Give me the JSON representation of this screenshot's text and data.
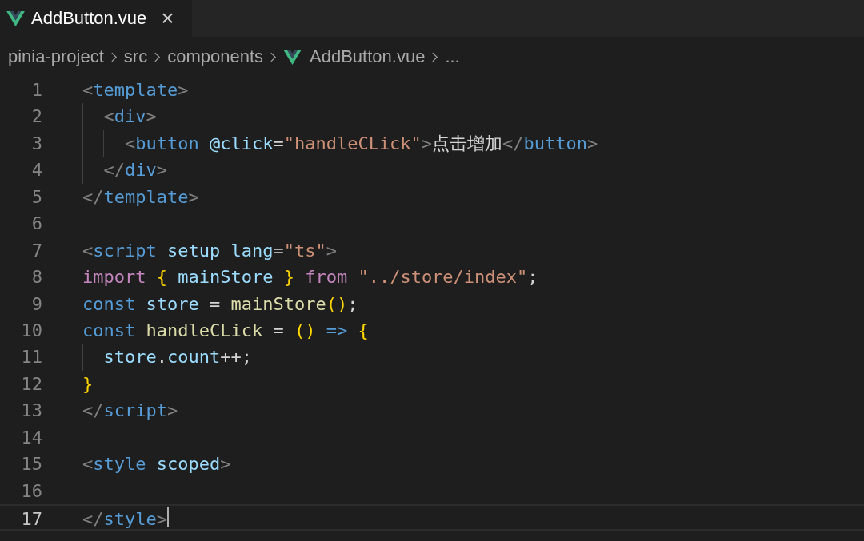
{
  "tabs": [
    {
      "label": "AddButton.vue",
      "selected": true,
      "close": "×"
    }
  ],
  "breadcrumb": [
    {
      "text": "pinia-project",
      "kind": "folder"
    },
    {
      "text": "src",
      "kind": "folder"
    },
    {
      "text": "components",
      "kind": "folder"
    },
    {
      "text": "AddButton.vue",
      "kind": "vue"
    },
    {
      "text": "...",
      "kind": "more"
    }
  ],
  "code": [
    {
      "number": "1",
      "current": false,
      "tokens": [
        {
          "t": "<",
          "color": "#808080"
        },
        {
          "t": "template",
          "color": "#569cd6"
        },
        {
          "t": ">",
          "color": "#808080"
        }
      ]
    },
    {
      "number": "2",
      "current": false,
      "tokens": [
        {
          "t": "  <",
          "color": "#808080"
        },
        {
          "t": "div",
          "color": "#569cd6"
        },
        {
          "t": ">",
          "color": "#808080"
        }
      ]
    },
    {
      "number": "3",
      "current": false,
      "tokens": [
        {
          "t": "    <",
          "color": "#808080"
        },
        {
          "t": "button",
          "color": "#569cd6"
        },
        {
          "t": " @click",
          "color": "#9cdcfe"
        },
        {
          "t": "=",
          "color": "#d4d4d4"
        },
        {
          "t": "\"handleCLick\"",
          "color": "#ce9178"
        },
        {
          "t": ">",
          "color": "#808080"
        },
        {
          "t": "点击增加",
          "color": "#d4d4d4"
        },
        {
          "t": "</",
          "color": "#808080"
        },
        {
          "t": "button",
          "color": "#569cd6"
        },
        {
          "t": ">",
          "color": "#808080"
        }
      ]
    },
    {
      "number": "4",
      "current": false,
      "tokens": [
        {
          "t": "  </",
          "color": "#808080"
        },
        {
          "t": "div",
          "color": "#569cd6"
        },
        {
          "t": ">",
          "color": "#808080"
        }
      ]
    },
    {
      "number": "5",
      "current": false,
      "tokens": [
        {
          "t": "</",
          "color": "#808080"
        },
        {
          "t": "template",
          "color": "#569cd6"
        },
        {
          "t": ">",
          "color": "#808080"
        }
      ]
    },
    {
      "number": "6",
      "current": false
    },
    {
      "number": "7",
      "current": false,
      "tokens": [
        {
          "t": "<",
          "color": "#808080"
        },
        {
          "t": "script",
          "color": "#569cd6"
        },
        {
          "t": " setup lang",
          "color": "#9cdcfe"
        },
        {
          "t": "=",
          "color": "#d4d4d4"
        },
        {
          "t": "\"ts\"",
          "color": "#ce9178"
        },
        {
          "t": ">",
          "color": "#808080"
        }
      ]
    },
    {
      "number": "8",
      "current": false,
      "tokens": [
        {
          "t": "import ",
          "color": "#c586c0"
        },
        {
          "t": "{",
          "color": "#ffd700"
        },
        {
          "t": " mainStore ",
          "color": "#9cdcfe"
        },
        {
          "t": "}",
          "color": "#ffd700"
        },
        {
          "t": " from ",
          "color": "#c586c0"
        },
        {
          "t": "\"../store/index\"",
          "color": "#ce9178"
        },
        {
          "t": ";",
          "color": "#d4d4d4"
        }
      ]
    },
    {
      "number": "9",
      "current": false,
      "tokens": [
        {
          "t": "const",
          "color": "#569cd6"
        },
        {
          "t": " store ",
          "color": "#9cdcfe"
        },
        {
          "t": "= ",
          "color": "#d4d4d4"
        },
        {
          "t": "mainStore",
          "color": "#dcdcaa"
        },
        {
          "t": "()",
          "color": "#ffd700"
        },
        {
          "t": ";",
          "color": "#d4d4d4"
        }
      ]
    },
    {
      "number": "10",
      "current": false,
      "tokens": [
        {
          "t": "const",
          "color": "#569cd6"
        },
        {
          "t": " handleCLick",
          "color": "#dcdcaa"
        },
        {
          "t": " = ",
          "color": "#d4d4d4"
        },
        {
          "t": "()",
          "color": "#ffd700"
        },
        {
          "t": " => ",
          "color": "#569cd6"
        },
        {
          "t": "{",
          "color": "#ffd700"
        }
      ]
    },
    {
      "number": "11",
      "current": false,
      "tokens": [
        {
          "t": "  store",
          "color": "#9cdcfe"
        },
        {
          "t": ".",
          "color": "#d4d4d4"
        },
        {
          "t": "count",
          "color": "#9cdcfe"
        },
        {
          "t": "++;",
          "color": "#d4d4d4"
        }
      ]
    },
    {
      "number": "12",
      "current": false,
      "tokens": [
        {
          "t": "}",
          "color": "#ffd700"
        }
      ]
    },
    {
      "number": "13",
      "current": false,
      "tokens": [
        {
          "t": "</",
          "color": "#808080"
        },
        {
          "t": "script",
          "color": "#569cd6"
        },
        {
          "t": ">",
          "color": "#808080"
        }
      ]
    },
    {
      "number": "14",
      "current": false
    },
    {
      "number": "15",
      "current": false,
      "tokens": [
        {
          "t": "<",
          "color": "#808080"
        },
        {
          "t": "style",
          "color": "#569cd6"
        },
        {
          "t": " scoped",
          "color": "#9cdcfe"
        },
        {
          "t": ">",
          "color": "#808080"
        }
      ]
    },
    {
      "number": "16",
      "current": false
    },
    {
      "number": "17",
      "current": true,
      "tokens": [
        {
          "t": "</",
          "color": "#808080"
        },
        {
          "t": "style",
          "color": "#569cd6"
        },
        {
          "t": ">",
          "color": "#808080"
        }
      ]
    }
  ]
}
